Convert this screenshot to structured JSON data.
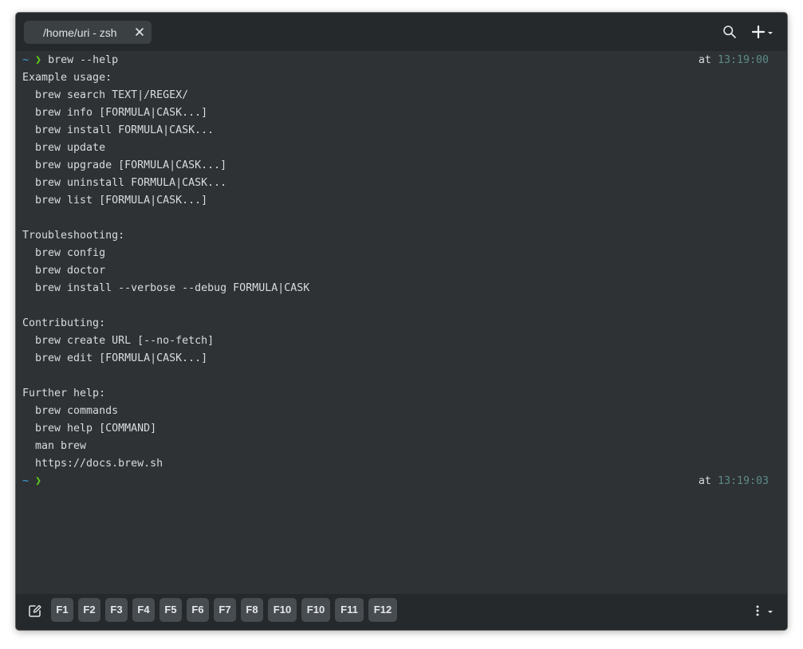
{
  "tab": {
    "title": "/home/uri - zsh"
  },
  "icons": {
    "tab_close": "close-icon",
    "search": "search-icon",
    "new_tab": "plus-icon",
    "new_tab_menu": "chevron-down-icon",
    "edit": "edit-icon",
    "more": "more-vertical-icon",
    "more_menu": "chevron-down-icon"
  },
  "terminal": {
    "prompt_tilde": "~",
    "prompt_arrow": "❯",
    "first_command": "brew --help",
    "first_at": "at",
    "first_time": "13:19:00",
    "output": [
      "Example usage:",
      "  brew search TEXT|/REGEX/",
      "  brew info [FORMULA|CASK...]",
      "  brew install FORMULA|CASK...",
      "  brew update",
      "  brew upgrade [FORMULA|CASK...]",
      "  brew uninstall FORMULA|CASK...",
      "  brew list [FORMULA|CASK...]",
      "",
      "Troubleshooting:",
      "  brew config",
      "  brew doctor",
      "  brew install --verbose --debug FORMULA|CASK",
      "",
      "Contributing:",
      "  brew create URL [--no-fetch]",
      "  brew edit [FORMULA|CASK...]",
      "",
      "Further help:",
      "  brew commands",
      "  brew help [COMMAND]",
      "  man brew",
      "  https://docs.brew.sh"
    ],
    "second_at": "at",
    "second_time": "13:19:03"
  },
  "function_keys": [
    "F1",
    "F2",
    "F3",
    "F4",
    "F5",
    "F6",
    "F7",
    "F8",
    "F10",
    "F10",
    "F11",
    "F12"
  ],
  "colors": {
    "background": "#2e3235",
    "bars": "#25292b",
    "prompt_tilde": "#3fa7e0",
    "prompt_arrow": "#5fd01a",
    "time": "#5d8a86"
  }
}
